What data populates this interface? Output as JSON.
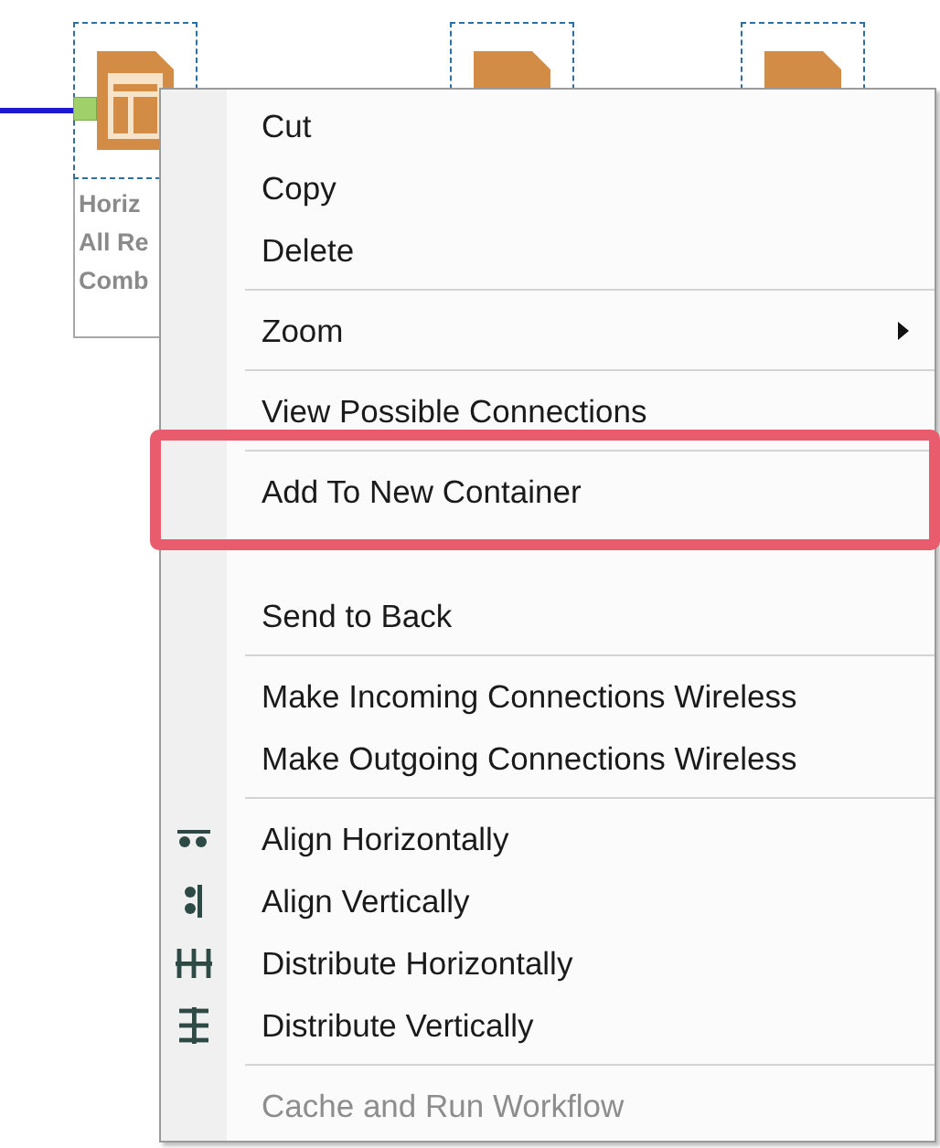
{
  "canvas": {
    "nodes": [
      {
        "kind": "table",
        "label_lines": [
          "Horiz",
          "All Re",
          "Comb"
        ],
        "has_input": true
      },
      {
        "kind": "plain"
      },
      {
        "kind": "plain"
      }
    ]
  },
  "context_menu": {
    "items": [
      {
        "kind": "item",
        "label": "Cut",
        "disabled": false
      },
      {
        "kind": "item",
        "label": "Copy",
        "disabled": false
      },
      {
        "kind": "item",
        "label": "Delete",
        "disabled": false
      },
      {
        "kind": "separator"
      },
      {
        "kind": "item",
        "label": "Zoom",
        "disabled": false,
        "submenu": true
      },
      {
        "kind": "separator"
      },
      {
        "kind": "item",
        "label": "View Possible Connections",
        "disabled": false
      },
      {
        "kind": "separator"
      },
      {
        "kind": "item",
        "label": "Add To New Container",
        "disabled": false,
        "annotated": true
      },
      {
        "kind": "covered"
      },
      {
        "kind": "item",
        "label": "Send to Back",
        "disabled": false
      },
      {
        "kind": "separator"
      },
      {
        "kind": "item",
        "label": "Make Incoming Connections Wireless",
        "disabled": false
      },
      {
        "kind": "item",
        "label": "Make Outgoing Connections Wireless",
        "disabled": false
      },
      {
        "kind": "separator"
      },
      {
        "kind": "tool-item",
        "label": "Align Horizontally",
        "disabled": false
      },
      {
        "kind": "tool-item",
        "label": "Align Vertically",
        "disabled": false
      },
      {
        "kind": "tool-item",
        "label": "Distribute Horizontally",
        "disabled": false
      },
      {
        "kind": "tool-item",
        "label": "Distribute Vertically",
        "disabled": false
      },
      {
        "kind": "separator"
      },
      {
        "kind": "item",
        "label": "Cache and Run Workflow",
        "disabled": true
      }
    ]
  }
}
